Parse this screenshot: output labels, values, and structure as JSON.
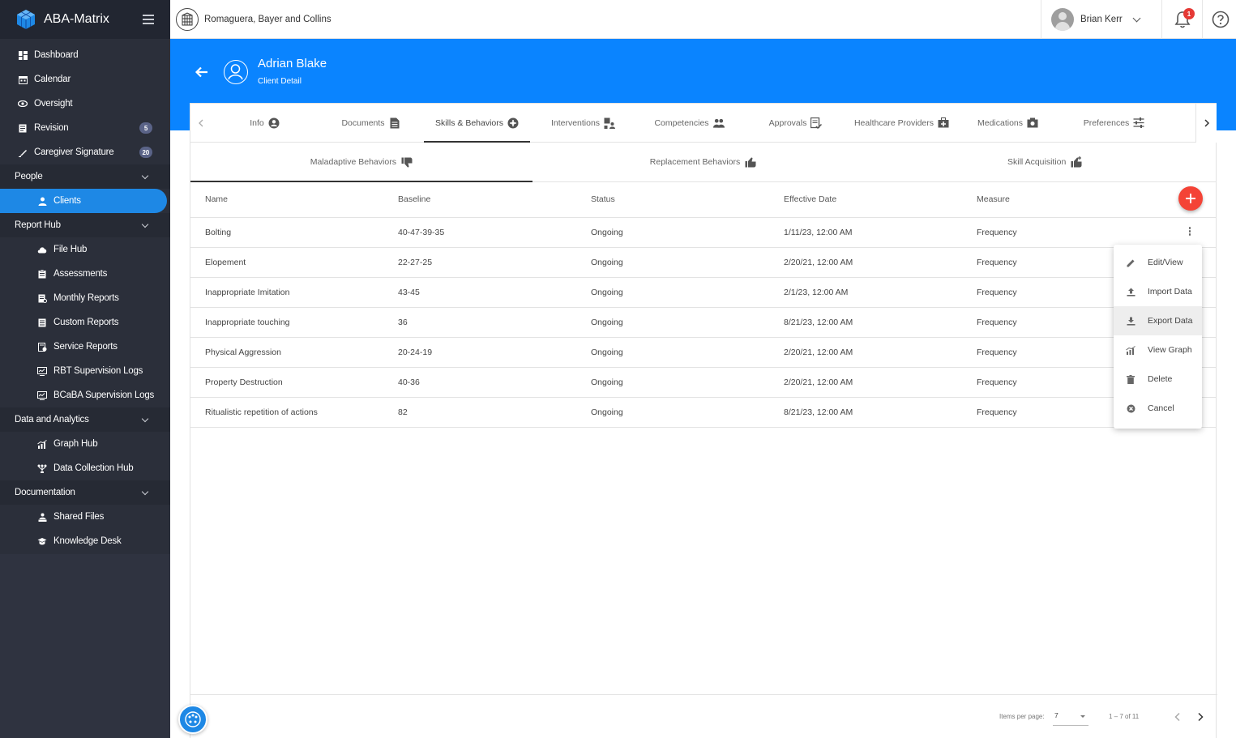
{
  "app": {
    "title": "ABA-Matrix"
  },
  "org": {
    "name": "Romaguera, Bayer and Collins"
  },
  "user": {
    "name": "Brian Kerr",
    "notifications": "1"
  },
  "sidebar": {
    "items": [
      {
        "label": "Dashboard",
        "icon": "dashboard-icon"
      },
      {
        "label": "Calendar",
        "icon": "calendar-icon"
      },
      {
        "label": "Oversight",
        "icon": "eye-icon"
      },
      {
        "label": "Revision",
        "icon": "document-icon",
        "badge": "5"
      },
      {
        "label": "Caregiver Signature",
        "icon": "signature-icon",
        "badge": "20"
      }
    ],
    "sections": {
      "people": {
        "label": "People",
        "items": [
          {
            "label": "Clients",
            "icon": "person-icon"
          }
        ]
      },
      "report_hub": {
        "label": "Report Hub",
        "items": [
          {
            "label": "File Hub",
            "icon": "cloud-icon"
          },
          {
            "label": "Assessments",
            "icon": "clipboard-icon"
          },
          {
            "label": "Monthly Reports",
            "icon": "report-icon"
          },
          {
            "label": "Custom Reports",
            "icon": "report-icon"
          },
          {
            "label": "Service Reports",
            "icon": "service-icon"
          },
          {
            "label": "RBT Supervision Logs",
            "icon": "log-icon"
          },
          {
            "label": "BCaBA Supervision Logs",
            "icon": "log-icon"
          }
        ]
      },
      "data_analytics": {
        "label": "Data and Analytics",
        "items": [
          {
            "label": "Graph Hub",
            "icon": "graph-icon"
          },
          {
            "label": "Data Collection Hub",
            "icon": "hub-icon"
          }
        ]
      },
      "documentation": {
        "label": "Documentation",
        "items": [
          {
            "label": "Shared Files",
            "icon": "shared-files-icon"
          },
          {
            "label": "Knowledge Desk",
            "icon": "knowledge-icon"
          }
        ]
      }
    }
  },
  "client": {
    "name": "Adrian Blake",
    "subtitle": "Client Detail"
  },
  "tabs": [
    {
      "label": "Info"
    },
    {
      "label": "Documents"
    },
    {
      "label": "Skills & Behaviors"
    },
    {
      "label": "Interventions"
    },
    {
      "label": "Competencies"
    },
    {
      "label": "Approvals"
    },
    {
      "label": "Healthcare Providers"
    },
    {
      "label": "Medications"
    },
    {
      "label": "Preferences"
    }
  ],
  "subtabs": [
    {
      "label": "Maladaptive Behaviors"
    },
    {
      "label": "Replacement Behaviors"
    },
    {
      "label": "Skill Acquisition"
    }
  ],
  "table": {
    "columns": [
      "Name",
      "Baseline",
      "Status",
      "Effective Date",
      "Measure"
    ],
    "rows": [
      [
        "Bolting",
        "40-47-39-35",
        "Ongoing",
        "1/11/23, 12:00 AM",
        "Frequency"
      ],
      [
        "Elopement",
        "22-27-25",
        "Ongoing",
        "2/20/21, 12:00 AM",
        "Frequency"
      ],
      [
        "Inappropriate Imitation",
        "43-45",
        "Ongoing",
        "2/1/23, 12:00 AM",
        "Frequency"
      ],
      [
        "Inappropriate touching",
        "36",
        "Ongoing",
        "8/21/23, 12:00 AM",
        "Frequency"
      ],
      [
        "Physical Aggression",
        "20-24-19",
        "Ongoing",
        "2/20/21, 12:00 AM",
        "Frequency"
      ],
      [
        "Property Destruction",
        "40-36",
        "Ongoing",
        "2/20/21, 12:00 AM",
        "Frequency"
      ],
      [
        "Ritualistic repetition of actions",
        "82",
        "Ongoing",
        "8/21/23, 12:00 AM",
        "Frequency"
      ]
    ]
  },
  "context_menu": {
    "items": [
      {
        "label": "Edit/View",
        "icon": "pencil-icon"
      },
      {
        "label": "Import Data",
        "icon": "upload-icon"
      },
      {
        "label": "Export Data",
        "icon": "download-icon"
      },
      {
        "label": "View Graph",
        "icon": "graph-icon"
      },
      {
        "label": "Delete",
        "icon": "trash-icon"
      },
      {
        "label": "Cancel",
        "icon": "cancel-icon"
      }
    ]
  },
  "pager": {
    "items_per_page_label": "Items per page:",
    "items_per_page": "7",
    "range": "1 – 7 of 11"
  },
  "colors": {
    "accent": "#0a84ff",
    "sidebar": "#2b2f3a",
    "active": "#1e88e5",
    "add": "#f44336"
  }
}
